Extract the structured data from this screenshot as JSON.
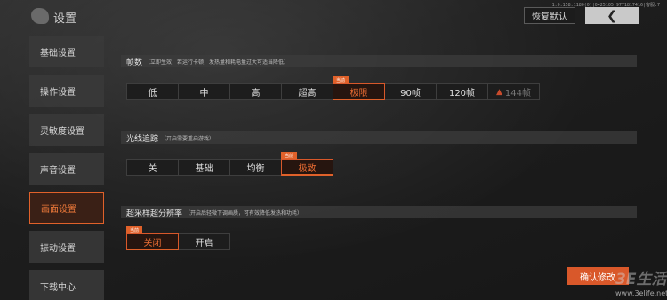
{
  "app": {
    "title": "设置",
    "version": "1.0.158.1180(0)|0425105|9771817416|客服:7"
  },
  "header": {
    "restore_label": "恢复默认",
    "back_icon": "chevron-left-icon"
  },
  "sidebar": {
    "items": [
      {
        "label": "基础设置"
      },
      {
        "label": "操作设置"
      },
      {
        "label": "灵敏度设置"
      },
      {
        "label": "声音设置"
      },
      {
        "label": "画面设置"
      },
      {
        "label": "振动设置"
      },
      {
        "label": "下载中心"
      }
    ],
    "active_index": 4
  },
  "sections": {
    "fps": {
      "title": "帧数",
      "note": "（立即生效，若运行卡顿，发热量和耗电量过大可适当降低）",
      "options": [
        "低",
        "中",
        "高",
        "超高",
        "极限",
        "90帧",
        "120帧",
        "144帧"
      ],
      "selected": 4,
      "current_tag": "当前",
      "disabled_option": "144帧"
    },
    "raytracing": {
      "title": "光线追踪",
      "note": "（开启需要重启游戏）",
      "options": [
        "关",
        "基础",
        "均衡",
        "极致"
      ],
      "selected": 3,
      "current_tag": "当前"
    },
    "supersampling": {
      "title": "超采样超分辨率",
      "note": "（开启后轻微下调画质，可有效降低发热和功耗）",
      "options": [
        "关闭",
        "开启"
      ],
      "selected": 0,
      "current_tag": "当前"
    }
  },
  "footer": {
    "confirm_label": "确认修改"
  },
  "watermark": {
    "site": "www.3elife.net",
    "logo_text": "3E生活"
  },
  "colors": {
    "accent": "#e0612a",
    "background": "#1b1b1b"
  }
}
